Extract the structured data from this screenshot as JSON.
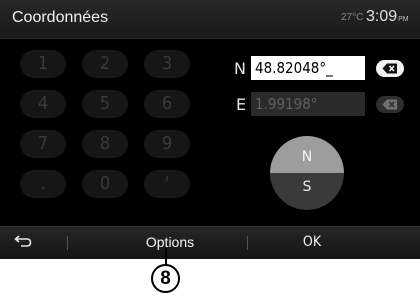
{
  "header": {
    "title": "Coordonnées",
    "temperature": "27°C",
    "time": "3:09",
    "time_suffix": "PM"
  },
  "keypad": {
    "keys": [
      "1",
      "2",
      "3",
      "4",
      "5",
      "6",
      "7",
      "8",
      "9",
      ".",
      "0",
      "'"
    ]
  },
  "coordinates": {
    "north_letter": "N",
    "north_value": "48.82048°_",
    "east_letter": "E",
    "east_value": "1.99198°"
  },
  "hemisphere": {
    "north": "N",
    "south": "S"
  },
  "footer": {
    "options_label": "Options",
    "ok_label": "OK"
  },
  "annotation": {
    "callout_number": "8"
  },
  "icons": {
    "back": "back-arrow-icon",
    "delete": "backspace-icon"
  },
  "colors": {
    "screen_bg": "#000000",
    "field_active_bg": "#ffffff",
    "field_inactive_bg": "#2a2a2a",
    "hemisphere_north": "#9d9d9d",
    "hemisphere_south": "#3a3a3a"
  }
}
